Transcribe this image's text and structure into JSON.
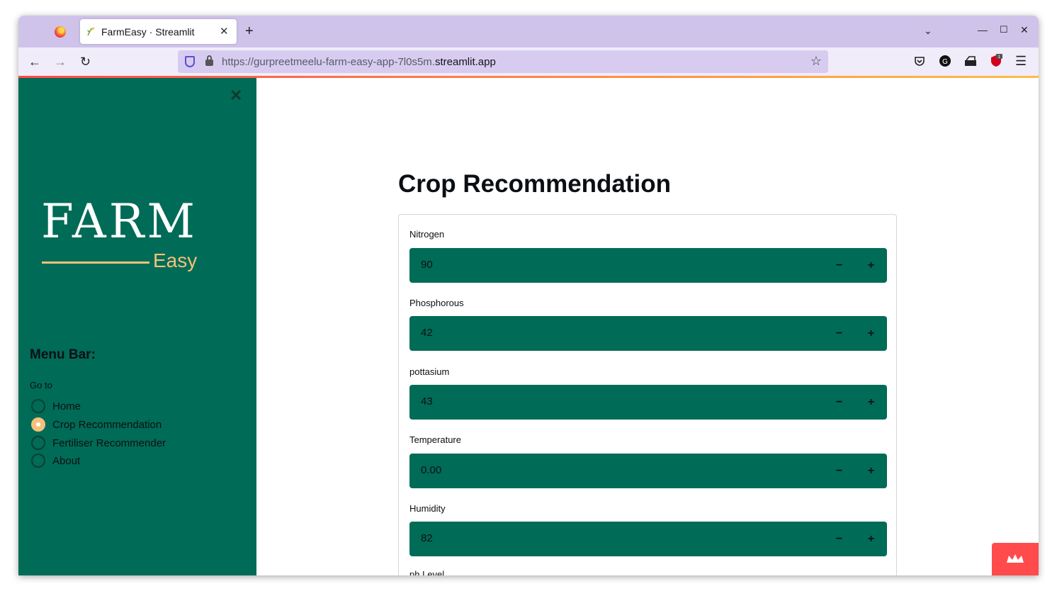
{
  "browser": {
    "tab_title": "FarmEasy · Streamlit",
    "url_prefix": "https://gurpreetmeelu-farm-easy-app-7l0s5m.",
    "url_domain": "streamlit.app",
    "extension_badge": "1"
  },
  "sidebar": {
    "logo_word": "FARM",
    "logo_sub": "Easy",
    "menu_title": "Menu Bar:",
    "goto_label": "Go to",
    "options": [
      "Home",
      "Crop Recommendation",
      "Fertiliser Recommender",
      "About"
    ],
    "selected": "Crop Recommendation"
  },
  "main": {
    "title": "Crop Recommendation",
    "fields": [
      {
        "label": "Nitrogen",
        "value": "90"
      },
      {
        "label": "Phosphorous",
        "value": "42"
      },
      {
        "label": "pottasium",
        "value": "43"
      },
      {
        "label": "Temperature",
        "value": "0.00"
      },
      {
        "label": "Humidity",
        "value": "82"
      }
    ],
    "next_label_partial": "ph Level"
  },
  "colors": {
    "sidebar_bg": "#006b56",
    "accent": "#f4c17a",
    "streamlit_red": "#ff4b4b"
  }
}
